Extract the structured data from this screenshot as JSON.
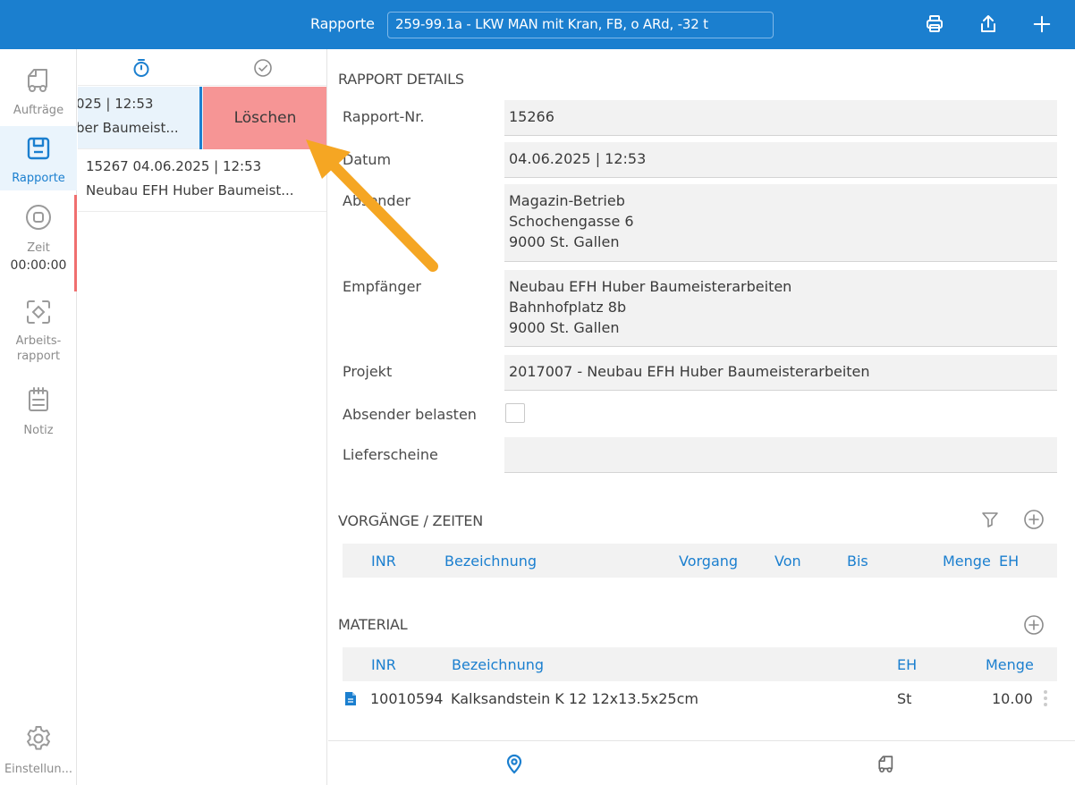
{
  "header": {
    "title": "Rapporte",
    "selected_vehicle": "259-99.1a - LKW MAN mit Kran, FB, o ARd, -32 t",
    "icons": [
      "printer-icon",
      "share-icon",
      "plus-icon"
    ]
  },
  "nav": {
    "items": [
      {
        "label": "Aufträge",
        "icon": "truck-icon"
      },
      {
        "label": "Rapporte",
        "icon": "report-icon"
      },
      {
        "label": "Zeit",
        "icon": "stop-icon",
        "time": "00:00:00"
      },
      {
        "label": "Arbeits-\nrapport",
        "label_lines": [
          "Arbeits-",
          "rapport"
        ],
        "icon": "scan-icon"
      },
      {
        "label": "Notiz",
        "icon": "notepad-icon"
      },
      {
        "label": "Einstellun...",
        "icon": "gear-icon"
      }
    ]
  },
  "list": {
    "rows": [
      {
        "line1": "025 | 12:53",
        "line2": "ber Baumeist...",
        "delete_label": "Löschen"
      },
      {
        "line1": "15267  04.06.2025 | 12:53",
        "line2": "Neubau EFH Huber Baumeist..."
      }
    ]
  },
  "details": {
    "section_title": "RAPPORT DETAILS",
    "fields": {
      "rapport_nr": {
        "label": "Rapport-Nr.",
        "value": "15266"
      },
      "datum": {
        "label": "Datum",
        "value": "04.06.2025 | 12:53"
      },
      "absender": {
        "label": "Absender",
        "lines": [
          "Magazin-Betrieb",
          "Schochengasse 6",
          "9000 St. Gallen"
        ]
      },
      "empfaenger": {
        "label": "Empfänger",
        "lines": [
          "Neubau EFH Huber Baumeisterarbeiten",
          "Bahnhofplatz 8b",
          "9000 St. Gallen"
        ]
      },
      "projekt": {
        "label": "Projekt",
        "value": "2017007 - Neubau EFH Huber Baumeisterarbeiten"
      },
      "absender_belasten": {
        "label": "Absender belasten",
        "checked": false
      },
      "lieferscheine": {
        "label": "Lieferscheine",
        "value": ""
      }
    }
  },
  "vorgaenge": {
    "section_title": "VORGÄNGE / ZEITEN",
    "columns": [
      "INR",
      "Bezeichnung",
      "Vorgang",
      "Von",
      "Bis",
      "Menge",
      "EH"
    ]
  },
  "material": {
    "section_title": "MATERIAL",
    "columns": [
      "INR",
      "Bezeichnung",
      "EH",
      "Menge"
    ],
    "rows": [
      {
        "inr": "10010594",
        "bezeichnung": "Kalksandstein K 12 12x13.5x25cm",
        "eh": "St",
        "menge": "10.00"
      }
    ]
  },
  "colors": {
    "accent": "#1b7fcf",
    "delete": "#f69595",
    "arrow": "#f5a623",
    "field_bg": "#f2f2f2"
  }
}
